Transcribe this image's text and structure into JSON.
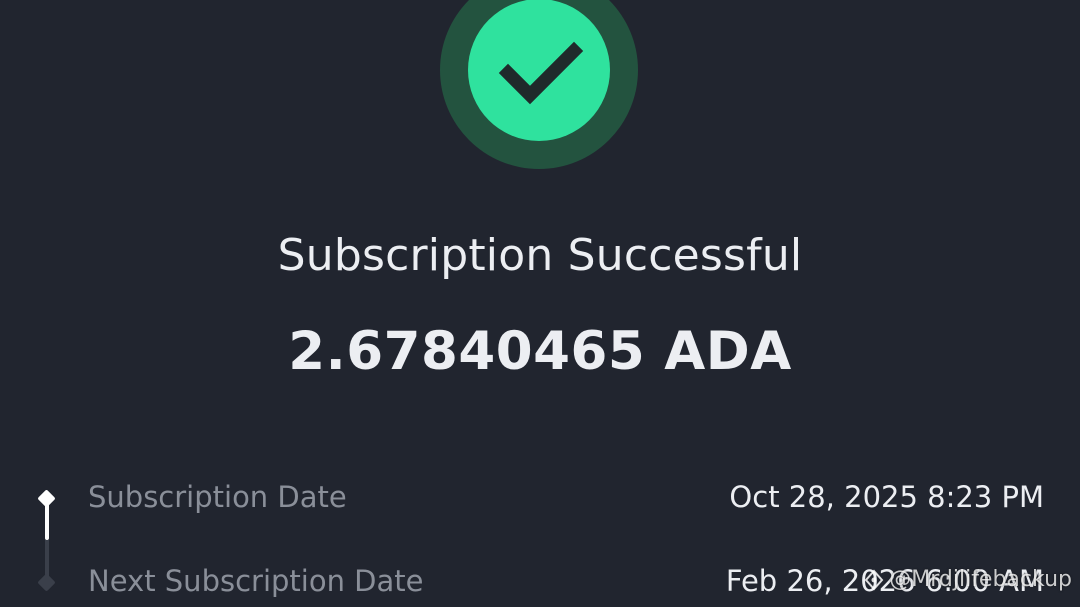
{
  "status": {
    "icon": "checkmark-icon",
    "colors": {
      "outer_ring": "#23533f",
      "inner_circle": "#2fe29e",
      "check": "#1f2a2b"
    }
  },
  "title": "Subscription Successful",
  "amount": "2.67840465 ADA",
  "details": [
    {
      "label": "Subscription Date",
      "value": "Oct 28, 2025 8:23 PM",
      "state": "completed"
    },
    {
      "label": "Next Subscription Date",
      "value": "Feb 26, 2026 6:00 AM",
      "state": "pending"
    }
  ],
  "watermark": {
    "icon": "rednote-logo-icon",
    "text": "@Mrdjlifebackup"
  },
  "colors": {
    "background": "#21252f",
    "primary_text": "#eceef2",
    "secondary_text": "#8a8f99"
  }
}
